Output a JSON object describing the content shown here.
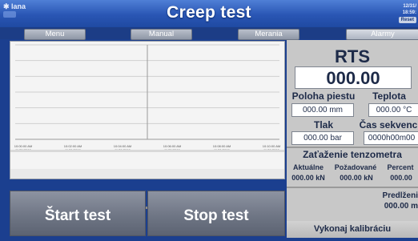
{
  "header": {
    "logo": "lana",
    "title": "Creep test",
    "clock_date": "12/31/",
    "clock_time": "18:59:",
    "clock_button": "Reset"
  },
  "nav": {
    "items": [
      {
        "label": "Menu"
      },
      {
        "label": "Manual"
      },
      {
        "label": "Merania"
      },
      {
        "label": "Alarmy"
      }
    ]
  },
  "chart_data": {
    "type": "line",
    "series": [],
    "x_ticks": [
      "10:00:00 AM 11/21/2000",
      "10:02:00 AM 11/21/2000",
      "10:04:00 AM 11/21/2000",
      "10:06:00 AM 11/21/2000",
      "10:08:00 AM 11/21/2000",
      "10:10:00 AM 11/21/2000"
    ],
    "grid": true
  },
  "actions": {
    "start_label": "Štart test",
    "stop_label": "Stop test"
  },
  "panel": {
    "rts_label": "RTS",
    "rts_value": "000.00",
    "poloha_label": "Poloha piestu",
    "poloha_value": "000.00 mm",
    "teplota_label": "Teplota",
    "teplota_value": "000.00 °C",
    "tlak_label": "Tlak",
    "tlak_value": "000.00 bar",
    "cas_label": "Čas sekvenc",
    "cas_value": "0000h00m00",
    "tenzometer_label": "Zaťaženie tenzometra",
    "aktualne_label": "Aktuálne",
    "pozadovane_label": "Požadované",
    "percent_label": "Percent",
    "aktualne_value": "000.00 kN",
    "pozadovane_value": "000.00 kN",
    "percent_value": "000.00",
    "predlzenie_label": "Predĺženi",
    "predlzenie_value": "000.00 m",
    "calibrate_label": "Vykonaj kalibráciu"
  },
  "colors": {
    "header": "#2a56b4",
    "background": "#1b3f8f",
    "panel": "#c8c8c8",
    "button": "#6f7685"
  }
}
